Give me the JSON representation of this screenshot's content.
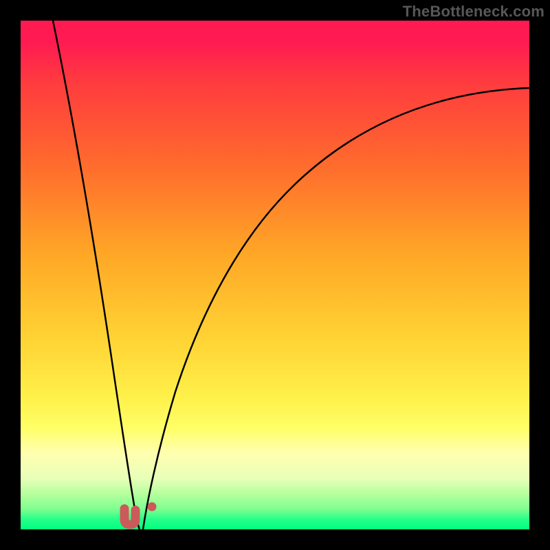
{
  "attribution": "TheBottleneck.com",
  "chart_data": {
    "type": "line",
    "title": "",
    "xlabel": "",
    "ylabel": "",
    "xlim": [
      0,
      100
    ],
    "ylim": [
      0,
      100
    ],
    "grid": false,
    "legend": false,
    "series": [
      {
        "name": "left-curve",
        "x": [
          0,
          5,
          10,
          15,
          18,
          20,
          22,
          23
        ],
        "values": [
          100,
          78,
          56,
          34,
          20,
          10,
          3,
          0
        ]
      },
      {
        "name": "right-curve",
        "x": [
          23,
          25,
          28,
          32,
          38,
          45,
          55,
          65,
          75,
          85,
          95,
          100
        ],
        "values": [
          0,
          6,
          18,
          33,
          48,
          59,
          69,
          76,
          80,
          83,
          85,
          86
        ]
      }
    ],
    "markers": [
      {
        "name": "u-marker",
        "x": 21.5,
        "y": 2,
        "shape": "u",
        "color": "#cc5a5a"
      },
      {
        "name": "dot-marker",
        "x": 25.5,
        "y": 3.5,
        "shape": "dot",
        "color": "#cc5a5a"
      }
    ],
    "baseline_color_bands": [
      {
        "y_start": 0,
        "y_end": 3,
        "color": "#00ff7f"
      },
      {
        "y_start": 3,
        "y_end": 10,
        "color": "#e8ffb8"
      },
      {
        "y_start": 10,
        "y_end": 22,
        "color": "#ffff66"
      },
      {
        "y_start": 22,
        "y_end": 40,
        "color": "#ffd233"
      },
      {
        "y_start": 40,
        "y_end": 60,
        "color": "#ffa726"
      },
      {
        "y_start": 60,
        "y_end": 80,
        "color": "#ff6a2d"
      },
      {
        "y_start": 80,
        "y_end": 100,
        "color": "#ff1a52"
      }
    ]
  }
}
